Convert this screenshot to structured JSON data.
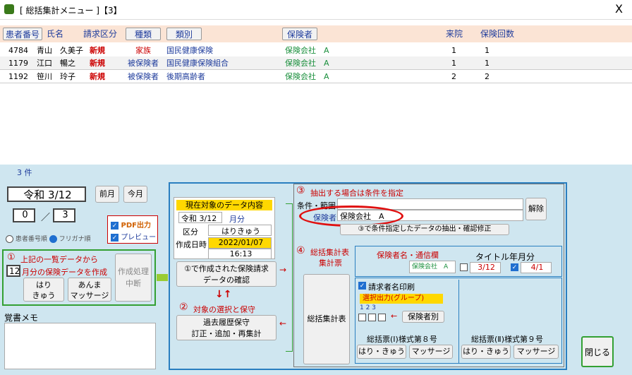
{
  "window": {
    "title": "[ 総括集計メニュー ]【3】",
    "close": "X"
  },
  "header": {
    "cols": [
      "患者番号",
      "氏名",
      "請求区分",
      "種類",
      "類別",
      "保険者",
      "来院",
      "保険回数"
    ]
  },
  "rows": [
    {
      "id": "4784",
      "name": "青山　久美子",
      "req": "新規",
      "kind": "家族",
      "cat": "国民健康保険",
      "ins": "保険会社　A",
      "visit": "1",
      "times": "1"
    },
    {
      "id": "1179",
      "name": "江口　暢之",
      "req": "新規",
      "kind": "被保険者",
      "cat": "国民健康保険組合",
      "ins": "保険会社　A",
      "visit": "1",
      "times": "1"
    },
    {
      "id": "1192",
      "name": "笹川　玲子",
      "req": "新規",
      "kind": "被保険者",
      "cat": "後期高齢者",
      "ins": "保険会社　A",
      "visit": "2",
      "times": "2"
    }
  ],
  "count": "3 件",
  "date": {
    "main": "令和 3/12",
    "prev": "前月",
    "cur": "今月",
    "num1": "0",
    "sep": "／",
    "num2": "3"
  },
  "output": {
    "pdf": "PDF出力",
    "preview": "プレビュー"
  },
  "sort": {
    "a": "患者番号順",
    "b": "フリガナ順"
  },
  "step1": {
    "num": "①",
    "l1": "上記の一覧データから",
    "month": "12",
    "l2": "月分の保険データを作成",
    "hari": "はり\nきゅう",
    "anma": "あんま\nマッサージ",
    "stop": "作成処理\n中断"
  },
  "memo": {
    "label": "覚書メモ"
  },
  "current": {
    "title": "現在対象のデータ内容",
    "date": "令和 3/12",
    "month": "月分",
    "k_label": "区分",
    "k_val": "はりきゅう",
    "c_label": "作成日時",
    "c_date": "2022/01/07",
    "c_time": "16:13",
    "confirm": "①で作成された保険請求\nデータの確認"
  },
  "step2": {
    "num": "②",
    "label": "対象の選択と保守",
    "btn": "過去履歴保守\n訂正・追加・再集計"
  },
  "step3": {
    "num": "③",
    "label": "抽出する場合は条件を指定",
    "cond": "条件・範囲",
    "ins_label": "保険者",
    "ins_val": "保険会社　A",
    "clear": "解除",
    "extract": "③で条件指定したデータの抽出・確認修正"
  },
  "step4": {
    "num": "④",
    "l1": "総括集計表",
    "l2": "集計票",
    "btn": "総括集計表"
  },
  "insurer_box": {
    "title": "保険者名・通信欄",
    "val": "保険会社　A"
  },
  "titledate": {
    "title": "タイトル年月分",
    "a": "3/12",
    "b": "4/1"
  },
  "print": {
    "claimant": "請求者名印刷",
    "group": "選択出力(グループ)",
    "nums": "1  2  3",
    "ins_btn": "保険者別",
    "f1": "総括票(Ⅰ)様式第８号",
    "f2": "総括票(Ⅱ)様式第９号",
    "hari": "はり・きゅう",
    "mass": "マッサージ"
  },
  "close": "閉じる",
  "colors": {
    "accent": "#2a7fc0",
    "header": "#fbe4d5",
    "panel": "#cfe6f0",
    "highlight": "#ffd800",
    "oval": "#e01010"
  }
}
